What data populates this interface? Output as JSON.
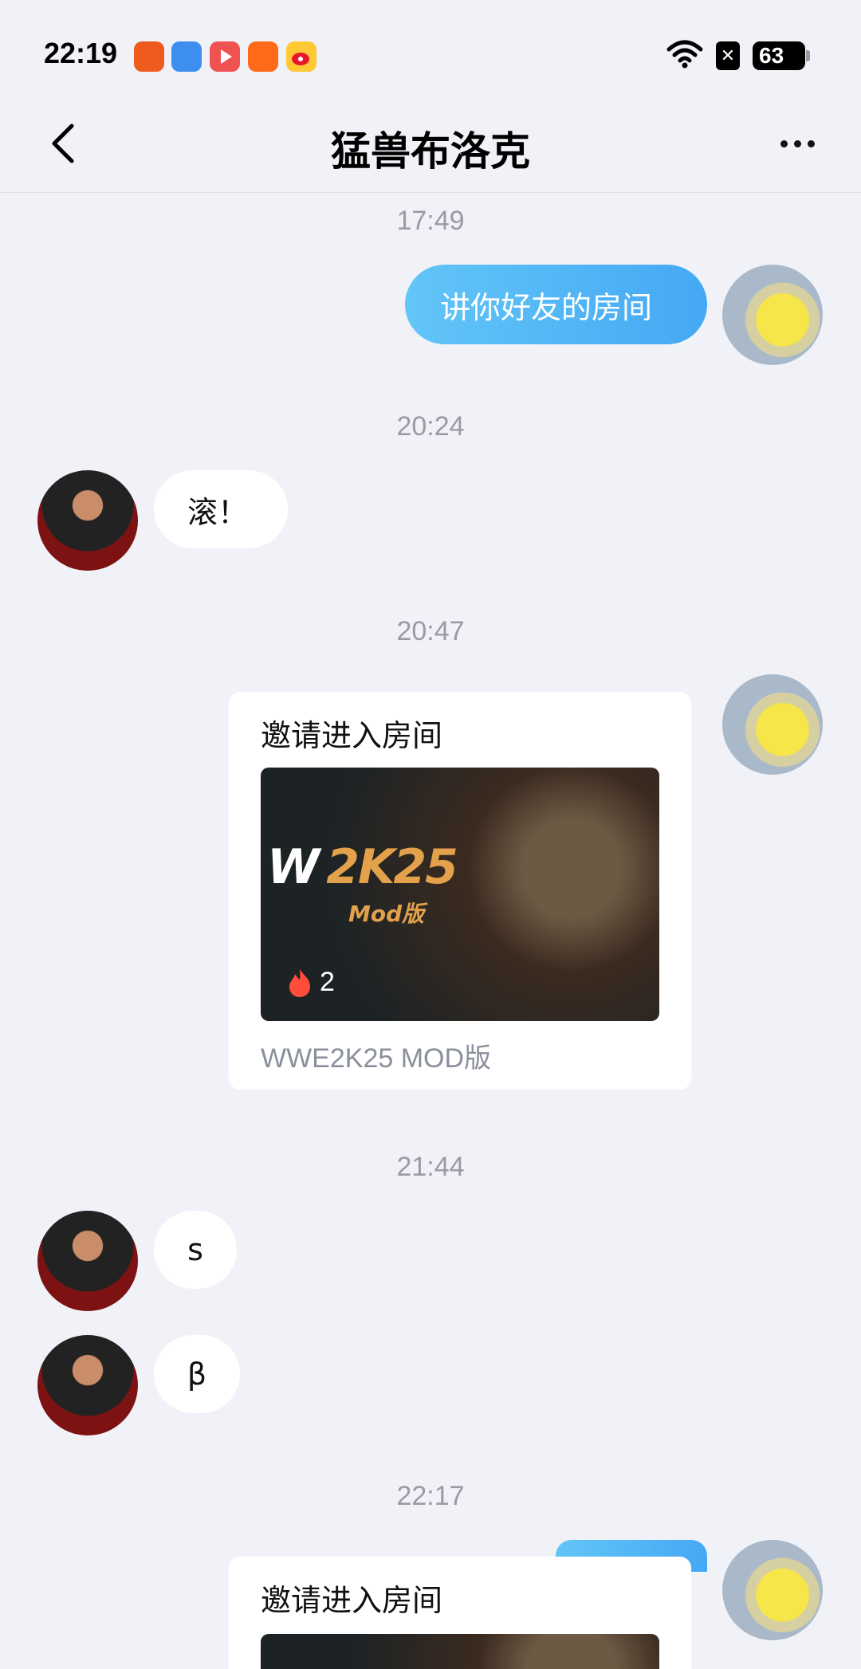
{
  "status_bar": {
    "time": "22:19",
    "notification_icons": [
      "app-icon-orange",
      "game-controller-icon",
      "video-play-icon",
      "kuaishou-icon",
      "weibo-icon"
    ],
    "battery": "63",
    "icons": [
      "wifi-icon",
      "close-box-icon",
      "battery-icon"
    ]
  },
  "nav": {
    "title": "猛兽布洛克",
    "back_icon": "chevron-left-icon",
    "more_icon": "more-dots-icon"
  },
  "messages": [
    {
      "type": "timestamp",
      "text": "17:49"
    },
    {
      "type": "text",
      "from": "self",
      "text": "讲你好友的房间"
    },
    {
      "type": "timestamp",
      "text": "20:24"
    },
    {
      "type": "text",
      "from": "other",
      "text": "滚！"
    },
    {
      "type": "timestamp",
      "text": "20:47"
    },
    {
      "type": "card",
      "from": "self",
      "title": "邀请进入房间",
      "game_logo": "2K25",
      "game_sub": "Mod版",
      "heat": "2",
      "caption": "WWE2K25 MOD版"
    },
    {
      "type": "timestamp",
      "text": "21:44"
    },
    {
      "type": "text",
      "from": "other",
      "text": "s"
    },
    {
      "type": "text",
      "from": "other",
      "text": "β"
    },
    {
      "type": "timestamp",
      "text": "22:17"
    },
    {
      "type": "card",
      "from": "self",
      "title": "邀请进入房间"
    }
  ],
  "colors": {
    "background": "#f1f2f8",
    "bubble_out_start": "#62c6f8",
    "bubble_out_end": "#45a8f4",
    "timestamp": "#9a9aa3",
    "heat_icon": "#ff4d3a"
  }
}
